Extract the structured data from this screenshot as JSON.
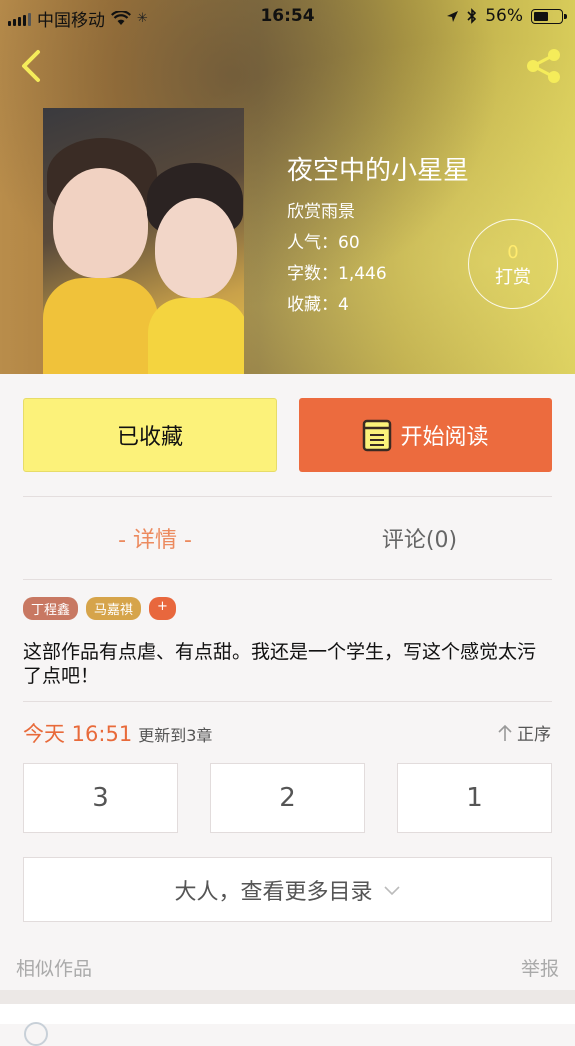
{
  "status_bar": {
    "carrier": "中国移动",
    "time": "16:54",
    "battery": "56%",
    "battery_level": 0.56
  },
  "book": {
    "title": "夜空中的小星星",
    "author": "欣赏雨景",
    "popularity": "人气：60",
    "word_count": "字数：1,446",
    "favorites": "收藏：4"
  },
  "tip": {
    "count": "0",
    "label": "打赏"
  },
  "actions": {
    "favorite_label": "已收藏",
    "read_label": "开始阅读"
  },
  "tabs": {
    "detail": "- 详情 -",
    "comments": "评论(0)"
  },
  "tags": [
    {
      "label": "丁程鑫",
      "color": "#c87862"
    },
    {
      "label": "马嘉祺",
      "color": "#d6a44a"
    },
    {
      "label": "+",
      "color": "#e8673d"
    }
  ],
  "description": "这部作品有点虐、有点甜。我还是一个学生，写这个感觉太污了点吧！",
  "update": {
    "time": "今天 16:51",
    "text": "更新到3章",
    "order_label": "正序"
  },
  "chapters": [
    "3",
    "2",
    "1"
  ],
  "more_label": "大人，查看更多目录",
  "footer": {
    "similar": "相似作品",
    "report": "举报"
  },
  "colors": {
    "accent": "#ec6b3e",
    "favorite_bg": "#fcf27a"
  }
}
